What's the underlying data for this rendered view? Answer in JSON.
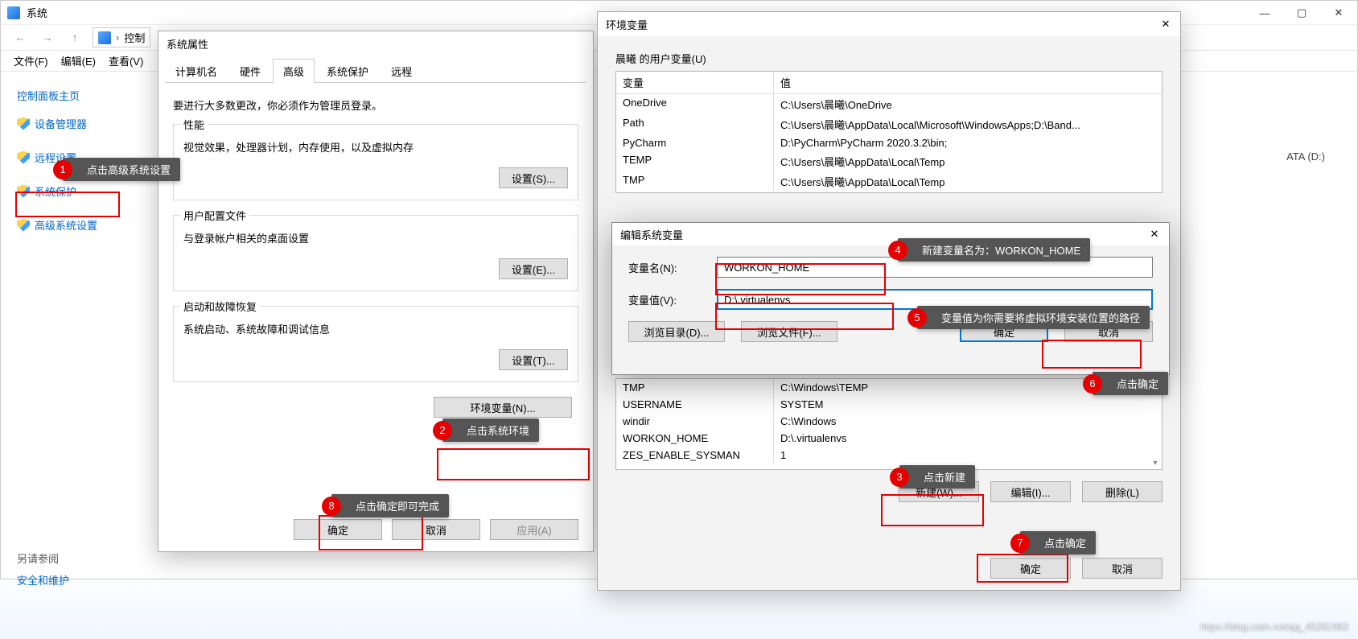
{
  "bg": {
    "title": "系统",
    "addr_control": "控制",
    "menus": [
      "文件(F)",
      "编辑(E)",
      "查看(V)"
    ],
    "left": {
      "home": "控制面板主页",
      "items": [
        "设备管理器",
        "远程设置",
        "系统保护",
        "高级系统设置"
      ],
      "see_also": "另请参阅",
      "security": "安全和维护"
    },
    "right_hint": "ATA (D:)"
  },
  "sysprops": {
    "title": "系统属性",
    "tabs": [
      "计算机名",
      "硬件",
      "高级",
      "系统保护",
      "远程"
    ],
    "note": "要进行大多数更改，你必须作为管理员登录。",
    "groups": {
      "perf": {
        "legend": "性能",
        "desc": "视觉效果，处理器计划，内存使用，以及虚拟内存",
        "btn": "设置(S)..."
      },
      "profile": {
        "legend": "用户配置文件",
        "desc": "与登录帐户相关的桌面设置",
        "btn": "设置(E)..."
      },
      "startup": {
        "legend": "启动和故障恢复",
        "desc": "系统启动、系统故障和调试信息",
        "btn": "设置(T)..."
      }
    },
    "env_btn": "环境变量(N)...",
    "footer": {
      "ok": "确定",
      "cancel": "取消",
      "apply": "应用(A)"
    }
  },
  "envdlg": {
    "title": "环境变量",
    "user_section": "晨曦 的用户变量(U)",
    "headers": {
      "var": "变量",
      "val": "值"
    },
    "user_vars": [
      {
        "var": "OneDrive",
        "val": "C:\\Users\\晨曦\\OneDrive"
      },
      {
        "var": "Path",
        "val": "C:\\Users\\晨曦\\AppData\\Local\\Microsoft\\WindowsApps;D:\\Band..."
      },
      {
        "var": "PyCharm",
        "val": "D:\\PyCharm\\PyCharm 2020.3.2\\bin;"
      },
      {
        "var": "TEMP",
        "val": "C:\\Users\\晨曦\\AppData\\Local\\Temp"
      },
      {
        "var": "TMP",
        "val": "C:\\Users\\晨曦\\AppData\\Local\\Temp"
      }
    ],
    "sys_vars": [
      {
        "var": "TMP",
        "val": "C:\\Windows\\TEMP"
      },
      {
        "var": "USERNAME",
        "val": "SYSTEM"
      },
      {
        "var": "windir",
        "val": "C:\\Windows"
      },
      {
        "var": "WORKON_HOME",
        "val": "D:\\.virtualenvs"
      },
      {
        "var": "ZES_ENABLE_SYSMAN",
        "val": "1"
      }
    ],
    "btns": {
      "new": "新建(W)...",
      "edit": "编辑(I)...",
      "delete": "删除(L)",
      "ok": "确定",
      "cancel": "取消"
    }
  },
  "editdlg": {
    "title": "编辑系统变量",
    "name_label": "变量名(N):",
    "name_value": "WORKON_HOME",
    "value_label": "变量值(V):",
    "value_value": "D:\\.virtualenvs",
    "browse_dir": "浏览目录(D)...",
    "browse_file": "浏览文件(F)...",
    "ok": "确定",
    "cancel": "取消"
  },
  "callouts": {
    "c1": "点击高级系统设置",
    "c2": "点击系统环境",
    "c3": "点击新建",
    "c4": "新建变量名为：WORKON_HOME",
    "c5": "变量值为你需要将虚拟环境安装位置的路径",
    "c6": "点击确定",
    "c7": "点击确定",
    "c8": "点击确定即可完成"
  },
  "watermark": "https://blog.csdn.net/qq_45261963"
}
